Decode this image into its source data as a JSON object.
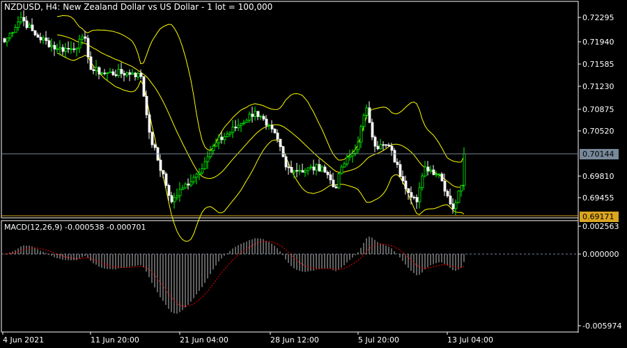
{
  "header": {
    "title": "NZDUSD, H4:  New Zealand Dollar vs US Dollar - 1 lot = 100,000"
  },
  "macd_panel": {
    "title": "MACD(12,26,9) -0.000538 -0.000701"
  },
  "price_tags": {
    "bid": {
      "value": "0.70144",
      "color": "#778899"
    },
    "line": {
      "value": "0.69171",
      "color": "#DAA520"
    }
  },
  "colors": {
    "bull": "#00FF00",
    "bear": "#FFFFFF",
    "bands": "#FFFF00",
    "signal": "#FF0000",
    "grid": "#FFFFFF"
  },
  "chart_data": [
    {
      "type": "candlestick",
      "symbol": "NZDUSD",
      "timeframe": "H4",
      "ylim": [
        0.6909,
        0.726
      ],
      "y_ticks": [
        "0.72295",
        "0.71940",
        "0.71585",
        "0.71230",
        "0.70875",
        "0.70520",
        "0.70144",
        "0.69810",
        "0.69455",
        "0.69171"
      ],
      "x_ticks": [
        "4 Jun 2021",
        "11 Jun 20:00",
        "21 Jun 04:00",
        "28 Jun 12:00",
        "5 Jul 20:00",
        "13 Jul 04:00"
      ],
      "indicators": [
        "Bollinger Bands(20,2)"
      ],
      "close_keypoints": [
        [
          0,
          0.7191
        ],
        [
          6,
          0.72295
        ],
        [
          11,
          0.7202
        ],
        [
          19,
          0.718
        ],
        [
          24,
          0.718
        ],
        [
          29,
          0.71966
        ],
        [
          31,
          0.71473
        ],
        [
          36,
          0.71418
        ],
        [
          46,
          0.71418
        ],
        [
          49,
          0.71363
        ],
        [
          52,
          0.70486
        ],
        [
          55,
          0.70047
        ],
        [
          60,
          0.69389
        ],
        [
          64,
          0.69609
        ],
        [
          69,
          0.69828
        ],
        [
          73,
          0.70102
        ],
        [
          76,
          0.70321
        ],
        [
          84,
          0.70595
        ],
        [
          90,
          0.70815
        ],
        [
          94,
          0.70595
        ],
        [
          98,
          0.70376
        ],
        [
          101,
          0.69938
        ],
        [
          106,
          0.69883
        ],
        [
          114,
          0.69938
        ],
        [
          119,
          0.69609
        ],
        [
          121,
          0.69938
        ],
        [
          126,
          0.70212
        ],
        [
          130,
          0.7087
        ],
        [
          133,
          0.70266
        ],
        [
          138,
          0.70266
        ],
        [
          143,
          0.69718
        ],
        [
          148,
          0.69389
        ],
        [
          151,
          0.69938
        ],
        [
          156,
          0.69828
        ],
        [
          161,
          0.6928
        ],
        [
          164,
          0.6965
        ],
        [
          165,
          0.70144
        ]
      ]
    },
    {
      "type": "histogram+line",
      "name": "MACD(12,26,9)",
      "main": -0.000538,
      "signal": -0.000701,
      "y_ticks": [
        "0.002563",
        "0.000000",
        "-0.005974"
      ],
      "ylim": [
        -0.005974,
        0.002563
      ]
    }
  ]
}
